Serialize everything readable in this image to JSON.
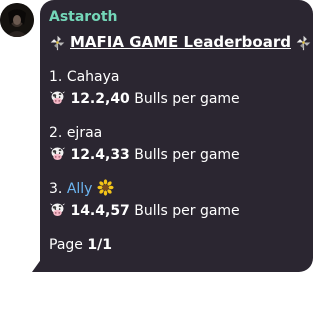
{
  "message": {
    "sender": "Astaroth",
    "title": "MAFIA GAME Leaderboard",
    "title_emoji_left": "pinwheel-icon",
    "title_emoji_right": "pinwheel-icon",
    "entries": [
      {
        "rank": "1.",
        "name": "Cahaya",
        "name_is_link": false,
        "name_emoji": "",
        "score_emoji": "cow-icon",
        "score": "12.2,40",
        "unit": "Bulls per game"
      },
      {
        "rank": "2.",
        "name": "ejraa",
        "name_is_link": false,
        "name_emoji": "",
        "score_emoji": "cow-icon",
        "score": "12.4,33",
        "unit": "Bulls per game"
      },
      {
        "rank": "3.",
        "name": "Ally",
        "name_is_link": true,
        "name_emoji": "sunflower-icon",
        "score_emoji": "cow-icon",
        "score": "14.4,57",
        "unit": "Bulls per game"
      }
    ],
    "page_label": "Page",
    "page_value": "1/1"
  },
  "colors": {
    "bubble_bg": "#2b2631",
    "sender": "#74d6b8",
    "link": "#6cb4f0",
    "text": "#ffffff"
  }
}
